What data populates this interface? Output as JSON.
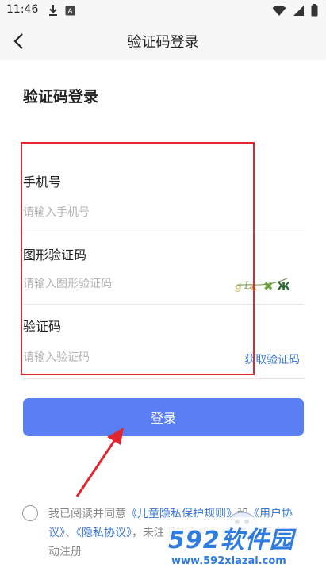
{
  "status_bar": {
    "time": "11:46"
  },
  "title_bar": {
    "title": "验证码登录"
  },
  "page": {
    "heading": "验证码登录"
  },
  "form": {
    "phone": {
      "label": "手机号",
      "placeholder": "请输入手机号",
      "value": ""
    },
    "captcha": {
      "label": "图形验证码",
      "placeholder": "请输入图形验证码",
      "value": ""
    },
    "sms_code": {
      "label": "验证码",
      "placeholder": "请输入验证码",
      "value": "",
      "get_code_label": "获取验证码"
    },
    "login_label": "登录"
  },
  "agreement": {
    "prefix": "我已阅读并同意",
    "link_children_privacy": "《儿童隐私保护规则》",
    "and": "和",
    "link_user": "《用户协议》",
    "sep": "、",
    "link_privacy": "《隐私协议》",
    "suffix": "，未注册的手机号登录成功后将自动注册"
  },
  "watermark": {
    "logo": "592软件园",
    "url": "www.592xiazai.com"
  },
  "colors": {
    "accent": "#5a7ff5",
    "link": "#3a78d8",
    "annotation": "#e0262f"
  }
}
